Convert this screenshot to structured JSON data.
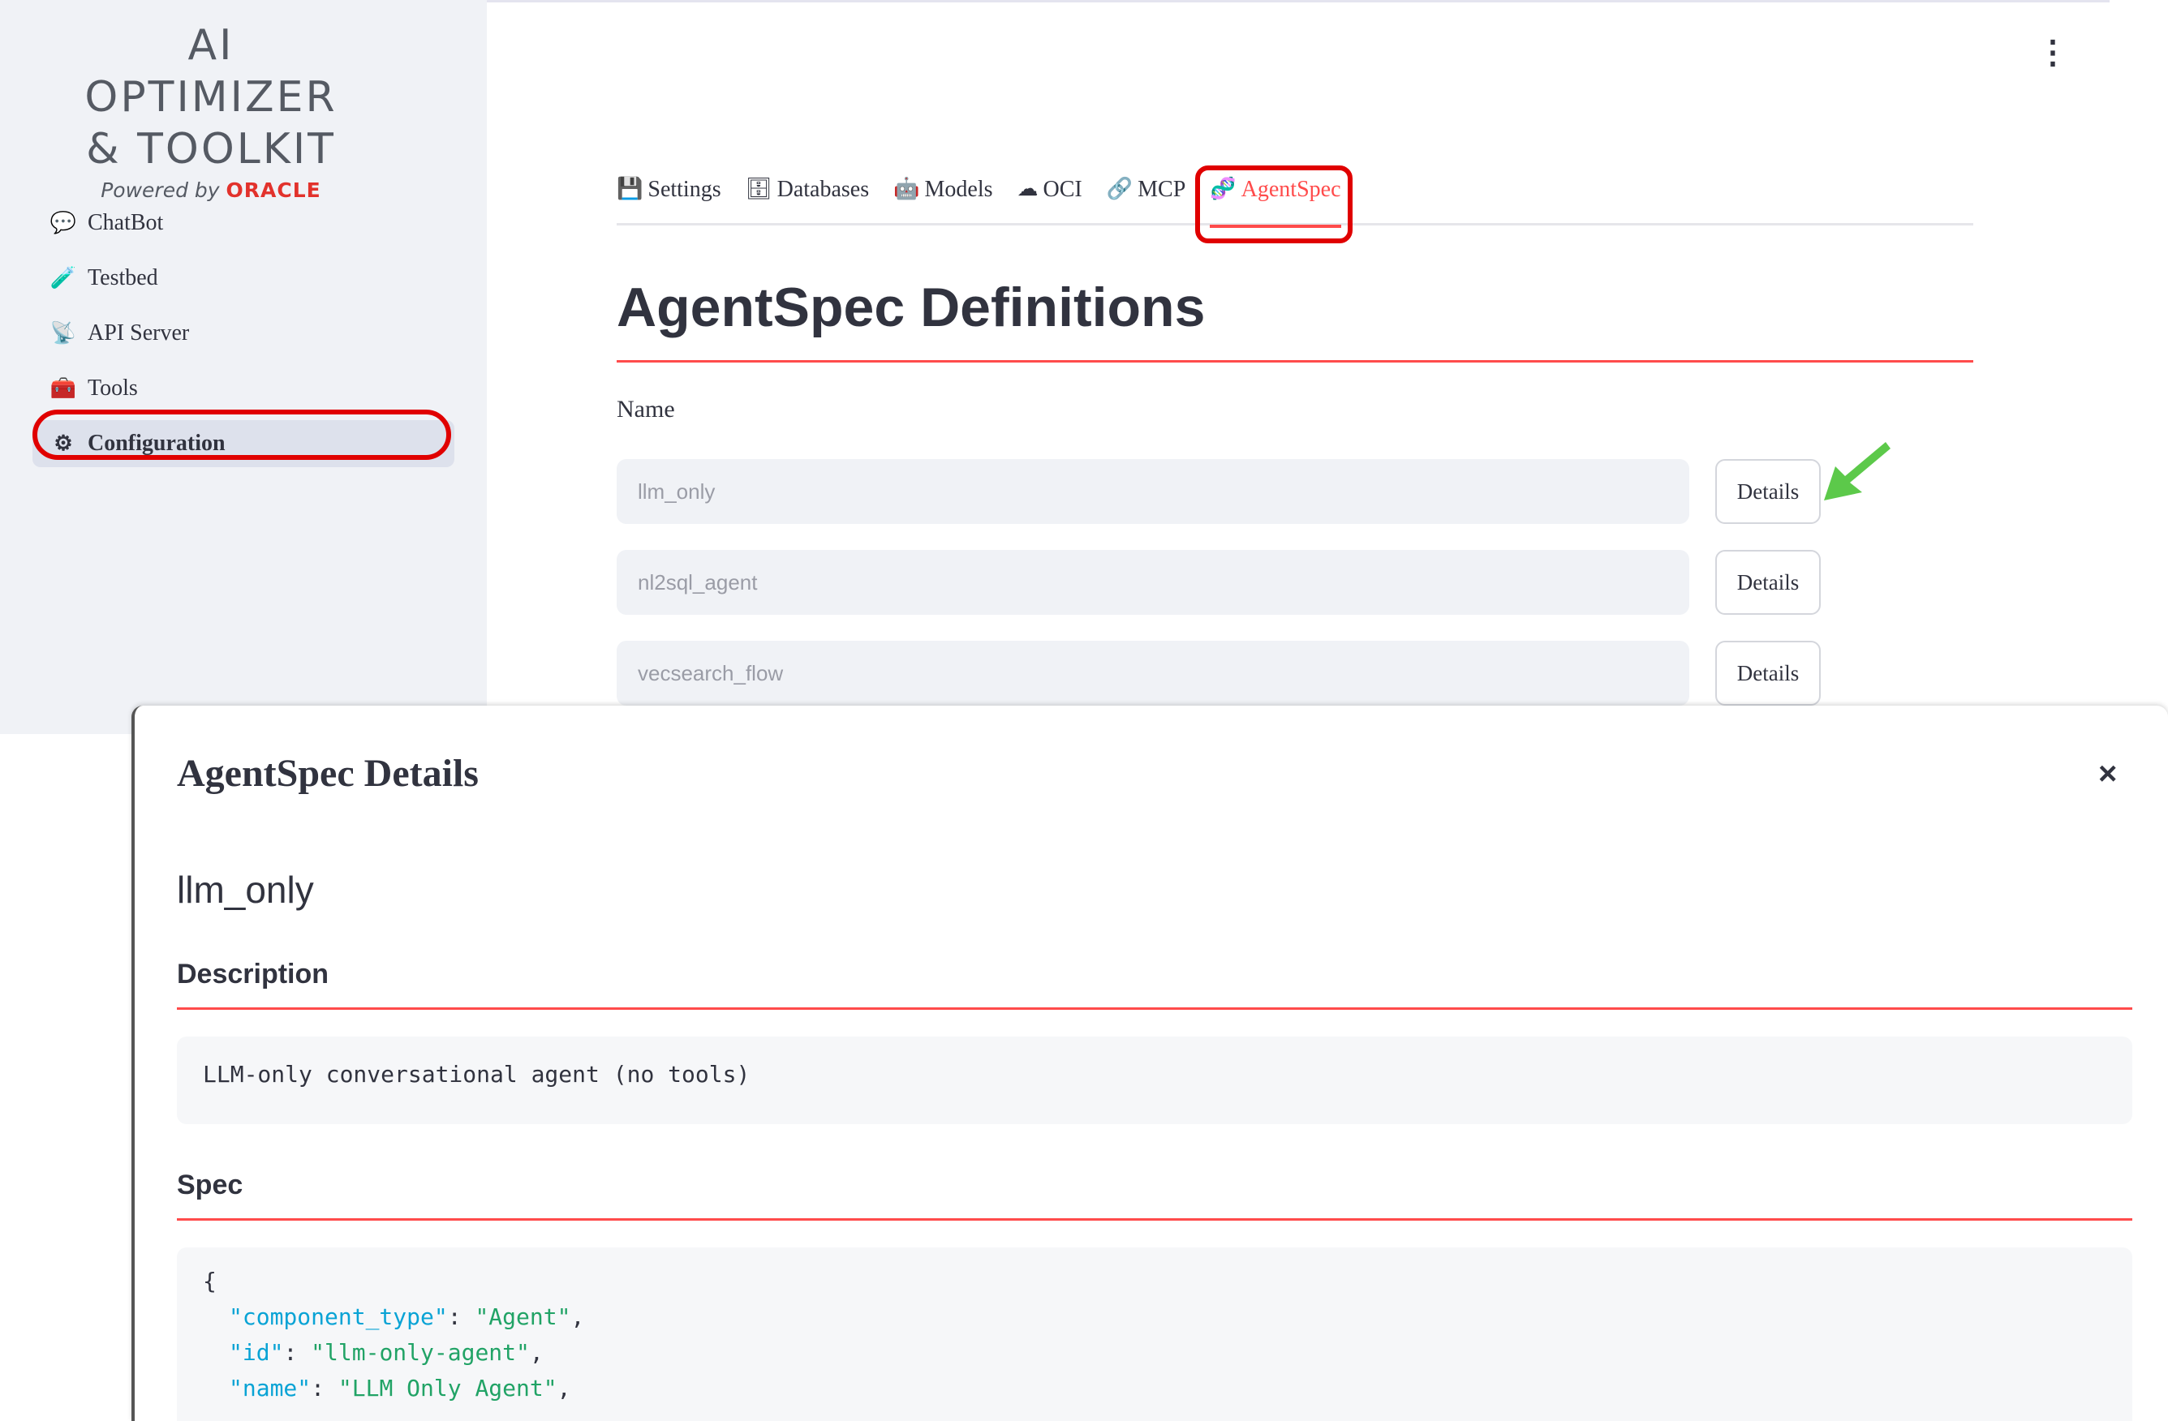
{
  "app": {
    "logo_line1": "AI OPTIMIZER",
    "logo_line2": "& TOOLKIT",
    "powered_by": "Powered by",
    "oracle": "ORACLE"
  },
  "sidebar": {
    "items": [
      {
        "label": "ChatBot",
        "icon": "speech-bubble-icon",
        "glyph": "💬"
      },
      {
        "label": "Testbed",
        "icon": "test-tube-icon",
        "glyph": "🧪"
      },
      {
        "label": "API Server",
        "icon": "satellite-icon",
        "glyph": "📡"
      },
      {
        "label": "Tools",
        "icon": "toolbox-icon",
        "glyph": "🧰"
      },
      {
        "label": "Configuration",
        "icon": "gear-icon",
        "glyph": "⚙"
      }
    ],
    "active": "Configuration"
  },
  "tabs": [
    {
      "label": "Settings",
      "glyph": "💾"
    },
    {
      "label": "Databases",
      "glyph": "🗄"
    },
    {
      "label": "Models",
      "glyph": "🤖"
    },
    {
      "label": "OCI",
      "glyph": "☁"
    },
    {
      "label": "MCP",
      "glyph": "🔗"
    },
    {
      "label": "AgentSpec",
      "glyph": "🧬"
    }
  ],
  "active_tab": "AgentSpec",
  "main": {
    "title": "AgentSpec Definitions",
    "name_label": "Name",
    "rows": [
      {
        "name": "llm_only",
        "button": "Details"
      },
      {
        "name": "nl2sql_agent",
        "button": "Details"
      },
      {
        "name": "vecsearch_flow",
        "button": "Details"
      }
    ]
  },
  "modal": {
    "title": "AgentSpec Details",
    "close": "×",
    "agent_name": "llm_only",
    "description_heading": "Description",
    "description": "LLM-only conversational agent (no tools)",
    "spec_heading": "Spec",
    "spec_open": "{",
    "spec_lines": [
      {
        "key": "\"component_type\"",
        "value": "\"Agent\""
      },
      {
        "key": "\"id\"",
        "value": "\"llm-only-agent\""
      },
      {
        "key": "\"name\"",
        "value": "\"LLM Only Agent\""
      }
    ]
  },
  "colors": {
    "accent": "#ff4b4b",
    "highlight": "#e00000",
    "sidebar_bg": "#f0f2f6",
    "json_key": "#09a3d5",
    "json_string": "#21a366"
  }
}
